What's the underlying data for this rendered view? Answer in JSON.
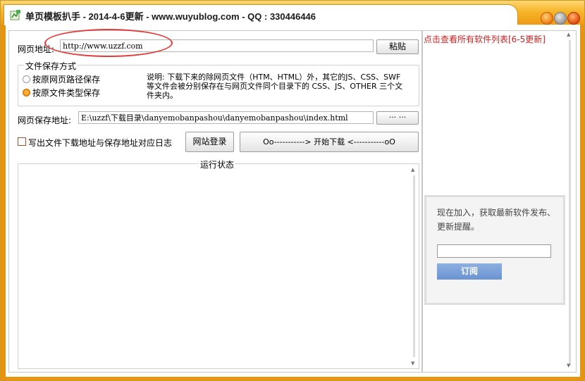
{
  "window": {
    "title": "单页模板扒手 - 2014-4-6更新 - www.wuyublog.com - QQ : 330446446",
    "accent_color": "#f2a418"
  },
  "form": {
    "url_label": "网页地址:",
    "url_value": "http://www.uzzf.com",
    "paste_button": "粘贴",
    "save_mode_group_title": "文件保存方式",
    "save_mode_options": [
      {
        "label": "按原网页路径保存",
        "selected": false
      },
      {
        "label": "按原文件类型保存",
        "selected": true
      }
    ],
    "description": "说明: 下载下来的除网页文件（HTM、HTML）外，其它的JS、CSS、SWF等文件会被分别保存在与网页文件同个目录下的 CSS、JS、OTHER 三个文件夹内。",
    "save_path_label": "网页保存地址:",
    "save_path_value": "E:\\uzzf\\下载目录\\danyemobanpashou\\danyemobanpashou\\index.html",
    "browse_button": "··· ···",
    "log_checkbox_label": "写出文件下载地址与保存地址对应日志",
    "log_checkbox_checked": false,
    "login_button": "网站登录",
    "download_button": "Oo-----------> 开始下载 <-----------oO",
    "status_group_title": "运行状态"
  },
  "sidebar": {
    "software_list_link": "点击查看所有软件列表[6-5更新]",
    "subscribe_text": "现在加入，获取最新软件发布、更新提醒。",
    "subscribe_input_value": "",
    "subscribe_button": "订阅"
  }
}
